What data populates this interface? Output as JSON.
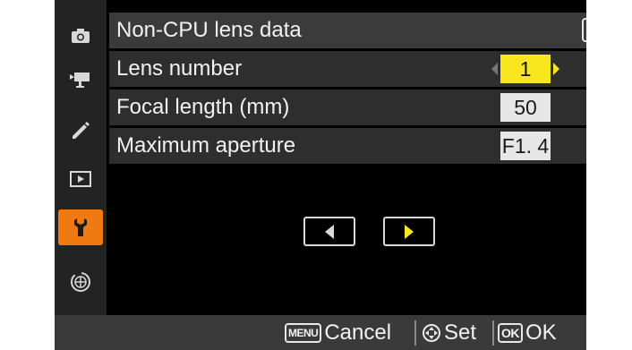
{
  "title": "Non-CPU lens data",
  "rows": [
    {
      "label": "Lens number",
      "value": "1"
    },
    {
      "label": "Focal length (mm)",
      "value": "50"
    },
    {
      "label": "Maximum aperture",
      "value": "F1. 4"
    }
  ],
  "sidebar": {
    "icons": [
      "camera-icon",
      "movie-camera-icon",
      "pencil-icon",
      "playback-icon",
      "wrench-icon",
      "network-icon",
      "my-menu-icon"
    ],
    "active": "wrench-icon"
  },
  "footer": {
    "cancel_badge": "MENU",
    "cancel_label": "Cancel",
    "set_label": "Set",
    "ok_badge": "OK",
    "ok_label": "OK"
  },
  "colors": {
    "accent": "#f07a12",
    "selected": "#f8e61f",
    "row_bg": "#2e2e2e"
  }
}
